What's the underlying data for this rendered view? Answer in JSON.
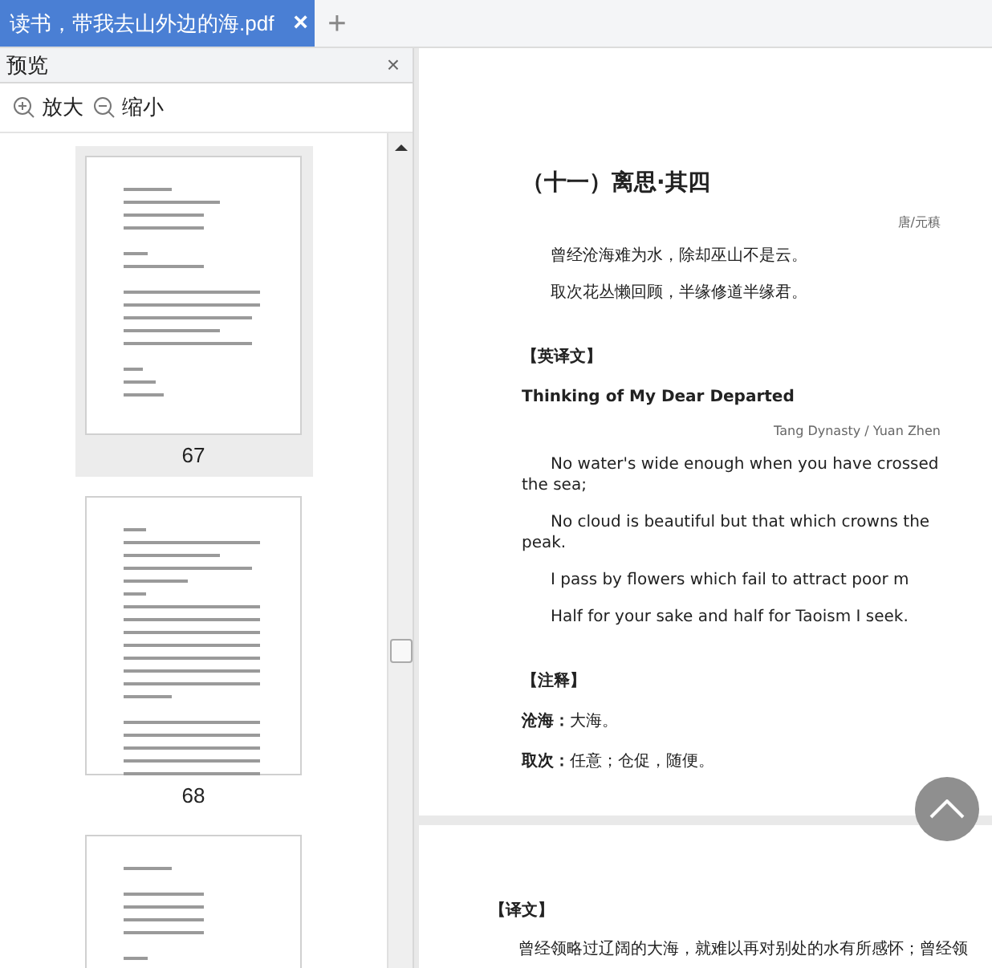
{
  "tab": {
    "title": "读书，带我去山外边的海.pdf",
    "close": "×",
    "selected": true
  },
  "new_tab": "+",
  "sidebar": {
    "title": "预览",
    "close": "×",
    "tools": [
      {
        "kind": "zoom-in",
        "label": "放大"
      },
      {
        "kind": "zoom-out",
        "label": "缩小"
      }
    ],
    "thumbnails": [
      {
        "page_label": "67",
        "selected": true
      },
      {
        "page_label": "68",
        "selected": false
      },
      {
        "selected": false
      }
    ]
  },
  "pages": [
    {
      "items": [
        {
          "kind": "heading",
          "text": "（十一）离思·其四"
        },
        {
          "kind": "attribution",
          "text": "唐/元稹"
        },
        {
          "kind": "verse",
          "text": "曾经沧海难为水，除却巫山不是云。"
        },
        {
          "kind": "verse",
          "text": "取次花丛懒回顾，半缘修道半缘君。"
        },
        {
          "kind": "section",
          "text": "【英译文】"
        },
        {
          "kind": "en_title",
          "text": "Thinking of My Dear Departed"
        },
        {
          "kind": "attribution",
          "text": "Tang Dynasty / Yuan Zhen"
        },
        {
          "kind": "verse",
          "text": "No water's wide enough when you have crossed the sea;"
        },
        {
          "kind": "verse",
          "text": "No cloud is beautiful but that which crowns the peak."
        },
        {
          "kind": "verse",
          "text": "I pass by flowers which fail to attract poor m"
        },
        {
          "kind": "verse",
          "text": "Half for your sake and half for Taoism I seek."
        },
        {
          "kind": "section",
          "text": "【注释】"
        },
        {
          "kind": "note",
          "term": "沧海：",
          "text": "大海。"
        },
        {
          "kind": "note",
          "term": "取次：",
          "text": "任意；仓促，随便。"
        }
      ]
    },
    {
      "items": [
        {
          "kind": "section",
          "text": "【译文】"
        },
        {
          "kind": "verse",
          "text": "曾经领略过辽阔的大海，就难以再对别处的水有所感怀；曾经领"
        }
      ]
    }
  ]
}
